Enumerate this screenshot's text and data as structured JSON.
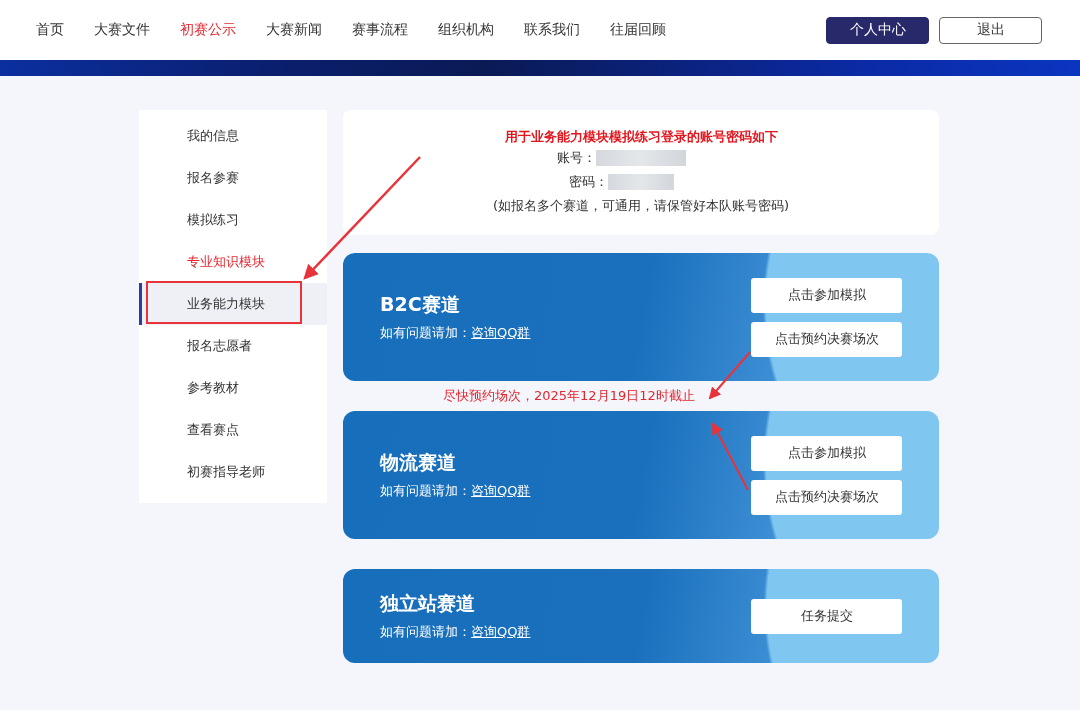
{
  "nav": {
    "items": [
      {
        "label": "首页",
        "selected": false
      },
      {
        "label": "大赛文件",
        "selected": false
      },
      {
        "label": "初赛公示",
        "selected": true
      },
      {
        "label": "大赛新闻",
        "selected": false
      },
      {
        "label": "赛事流程",
        "selected": false
      },
      {
        "label": "组织机构",
        "selected": false
      },
      {
        "label": "联系我们",
        "selected": false
      },
      {
        "label": "往届回顾",
        "selected": false
      }
    ],
    "buttons": [
      {
        "label": "个人中心",
        "kind": "primary"
      },
      {
        "label": "退出",
        "kind": "outline"
      }
    ]
  },
  "sidebar": {
    "items": [
      {
        "label": "我的信息",
        "selected": false,
        "highlighted": false
      },
      {
        "label": "报名参赛",
        "selected": false,
        "highlighted": false
      },
      {
        "label": "模拟练习",
        "selected": false,
        "highlighted": false
      },
      {
        "label": "专业知识模块",
        "selected": false,
        "highlighted": true
      },
      {
        "label": "业务能力模块",
        "selected": true,
        "highlighted": false
      },
      {
        "label": "报名志愿者",
        "selected": false,
        "highlighted": false
      },
      {
        "label": "参考教材",
        "selected": false,
        "highlighted": false
      },
      {
        "label": "查看赛点",
        "selected": false,
        "highlighted": false
      },
      {
        "label": "初赛指导老师",
        "selected": false,
        "highlighted": false
      }
    ]
  },
  "account_info": {
    "heading": "用于业务能力模块模拟练习登录的账号密码如下",
    "fields": [
      {
        "label": "账号："
      },
      {
        "label": "密码："
      }
    ],
    "note": "(如报名多个赛道，可通用，请保管好本队账号密码)"
  },
  "tracks": [
    {
      "title": "B2C赛道",
      "hint": "如有问题请加：",
      "link": "咨询QQ群",
      "buttons": [
        "点击参加模拟",
        "点击预约决赛场次"
      ],
      "note": "尽快预约场次，2025年12月19日12时截止"
    },
    {
      "title": "物流赛道",
      "hint": "如有问题请加：",
      "link": "咨询QQ群",
      "buttons": [
        "点击参加模拟",
        "点击预约决赛场次"
      ]
    },
    {
      "title": "独立站赛道",
      "hint": "如有问题请加：",
      "link": "咨询QQ群",
      "buttons": [
        "任务提交"
      ]
    }
  ]
}
